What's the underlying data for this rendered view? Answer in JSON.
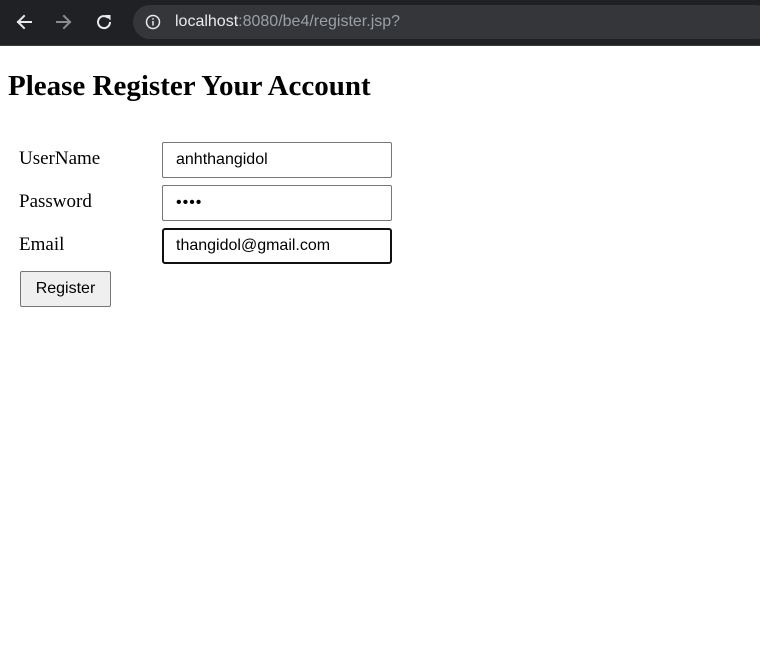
{
  "browser": {
    "url_host": "localhost",
    "url_rest": ":8080/be4/register.jsp?",
    "icons": {
      "back": "back-arrow-icon",
      "forward": "forward-arrow-icon",
      "reload": "reload-icon",
      "info": "info-icon"
    },
    "colors": {
      "toolbar": "#202124",
      "omnibox": "#35363a",
      "host_text": "#e8eaed",
      "path_text": "#9aa0a6"
    }
  },
  "form": {
    "title": "Please Register Your Account",
    "username": {
      "label": "UserName",
      "value": "anhthangidol"
    },
    "password": {
      "label": "Password",
      "value": "abcd"
    },
    "email": {
      "label": "Email",
      "value": "thangidol@gmail.com"
    },
    "submit_label": "Register"
  }
}
